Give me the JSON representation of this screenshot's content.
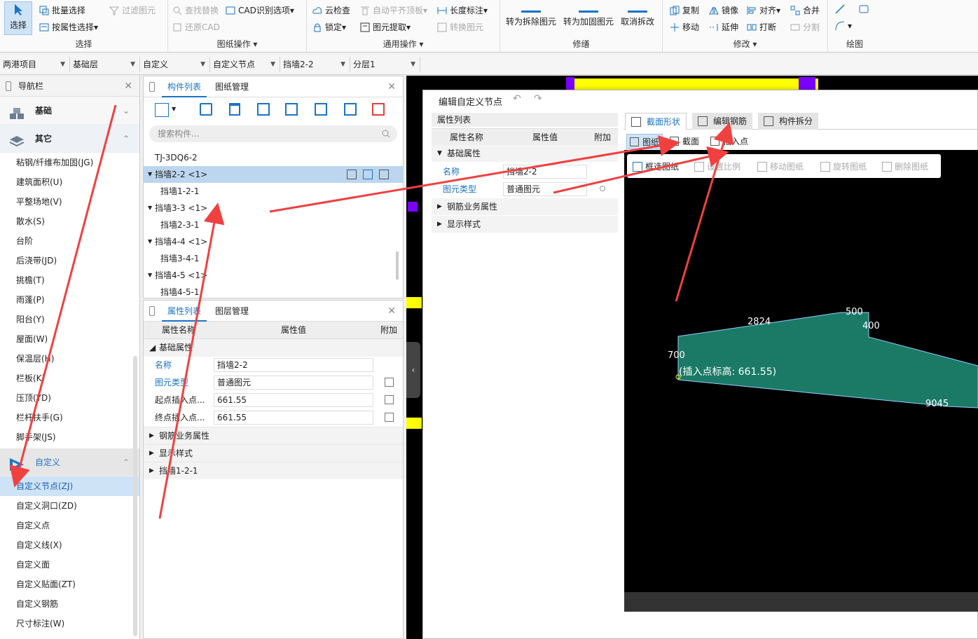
{
  "ribbon": {
    "select_group": {
      "select_label": "选择",
      "batch_select": "批量选择",
      "attr_select": "按属性选择",
      "filter": "过滤图元",
      "title": "选择"
    },
    "cad_group": {
      "find_replace": "查找替换",
      "cad_options": "CAD识别选项",
      "restore_cad": "还原CAD",
      "title": "图纸操作"
    },
    "common_group": {
      "cloud_check": "云检查",
      "auto_align": "自动平齐顶板",
      "length_dim": "长度标注",
      "lock": "锁定",
      "extract": "图元提取",
      "convert": "转换图元",
      "title": "通用操作"
    },
    "repair_group": {
      "to_demolish": "转为拆除图元",
      "to_reinforce": "转为加固图元",
      "cancel_demolish": "取消拆改",
      "title": "修缮"
    },
    "modify_group": {
      "copy": "复制",
      "mirror": "镜像",
      "align": "对齐",
      "merge": "合并",
      "move": "移动",
      "extend": "延伸",
      "break": "打断",
      "split": "分割",
      "title": "修改"
    },
    "draw_group": {
      "title": "绘图"
    }
  },
  "dropdowns": [
    "两港项目",
    "基础层",
    "自定义",
    "自定义节点",
    "挡墙2-2",
    "分层1"
  ],
  "nav": {
    "title": "导航栏",
    "group_foundation": "基础",
    "group_other": "其它",
    "other_items": [
      "粘钢/纤维布加固(JG)",
      "建筑面积(U)",
      "平整场地(V)",
      "散水(S)",
      "台阶",
      "后浇带(JD)",
      "挑檐(T)",
      "雨蓬(P)",
      "阳台(Y)",
      "屋面(W)",
      "保温层(H)",
      "栏板(K)",
      "压顶(YD)",
      "栏杆扶手(G)",
      "脚手架(JS)"
    ],
    "group_custom": "自定义",
    "custom_items": [
      "自定义节点(ZJ)",
      "自定义洞口(ZD)",
      "自定义点",
      "自定义线(X)",
      "自定义面",
      "自定义贴面(ZT)",
      "自定义钢筋",
      "尺寸标注(W)"
    ]
  },
  "comp_panel": {
    "tab_list": "构件列表",
    "tab_drawing": "图纸管理",
    "search_placeholder": "搜索构件...",
    "tree": [
      {
        "label": "TJ-3DQ6-2",
        "level": 0,
        "expand": false
      },
      {
        "label": "挡墙2-2 <1>",
        "level": 0,
        "expand": true
      },
      {
        "label": "挡墙1-2-1",
        "level": 1,
        "expand": false
      },
      {
        "label": "挡墙3-3 <1>",
        "level": 0,
        "expand": true
      },
      {
        "label": "挡墙2-3-1",
        "level": 1,
        "expand": false
      },
      {
        "label": "挡墙4-4 <1>",
        "level": 0,
        "expand": true
      },
      {
        "label": "挡墙3-4-1",
        "level": 1,
        "expand": false
      },
      {
        "label": "挡墙4-5 <1>",
        "level": 0,
        "expand": true
      },
      {
        "label": "挡墙4-5-1",
        "level": 1,
        "expand": false
      }
    ]
  },
  "prop_panel": {
    "tab_props": "属性列表",
    "tab_layers": "图层管理",
    "col_name": "属性名称",
    "col_value": "属性值",
    "col_extra": "附加",
    "group_basic": "基础属性",
    "rows": [
      {
        "name": "名称",
        "value": "挡墙2-2",
        "blue": true,
        "check": false
      },
      {
        "name": "图元类型",
        "value": "普通图元",
        "blue": true,
        "check": true
      },
      {
        "name": "起点插入点...",
        "value": "661.55",
        "blue": false,
        "check": true
      },
      {
        "name": "终点插入点...",
        "value": "661.55",
        "blue": false,
        "check": true
      }
    ],
    "collapsed": [
      "钢筋业务属性",
      "显示样式",
      "挡墙1-2-1"
    ]
  },
  "dialog": {
    "title": "编辑自定义节点",
    "prop_title": "属性列表",
    "col_name": "属性名称",
    "col_value": "属性值",
    "col_extra": "附加",
    "group_basic": "基础属性",
    "rows": [
      {
        "name": "名称",
        "value": "挡墙2-2"
      },
      {
        "name": "图元类型",
        "value": "普通图元"
      }
    ],
    "collapsed": [
      "钢筋业务属性",
      "显示样式"
    ],
    "tabs": [
      "截面形状",
      "编辑钢筋",
      "构件拆分"
    ],
    "subtabs": [
      "图纸",
      "截面",
      "插入点"
    ],
    "tools": [
      "框选图纸",
      "设置比例",
      "移动图纸",
      "旋转图纸",
      "删除图纸"
    ],
    "dims": {
      "d2824": "2824",
      "d500": "500",
      "d400": "400",
      "d700": "700",
      "d9045": "9045",
      "insert": "(插入点标高: 661.55)"
    }
  }
}
